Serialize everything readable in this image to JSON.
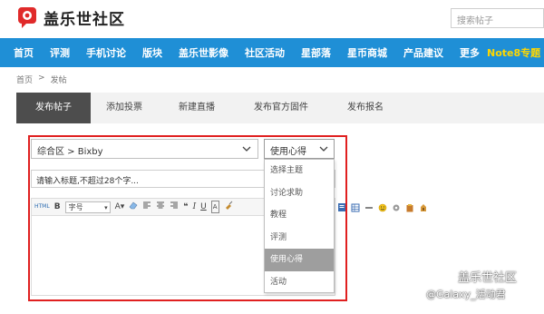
{
  "header": {
    "logo_text": "盖乐世社区",
    "search_placeholder": "搜索帖子"
  },
  "nav": {
    "items": [
      "首页",
      "评测",
      "手机讨论",
      "版块",
      "盖乐世影像",
      "社区活动",
      "星部落",
      "星币商城",
      "产品建议",
      "更多"
    ],
    "highlight": "Note8专题"
  },
  "breadcrumb": [
    "首页",
    ">",
    "发帖"
  ],
  "tabs": [
    {
      "label": "发布帖子",
      "active": true
    },
    {
      "label": "添加投票",
      "active": false
    },
    {
      "label": "新建直播",
      "active": false
    },
    {
      "label": "发布官方固件",
      "active": false
    },
    {
      "label": "发布报名",
      "active": false
    }
  ],
  "form": {
    "forum_select_value": "综合区 > Bixby",
    "type_select_value": "使用心得",
    "title_placeholder": "请输入标题,不超过28个字...",
    "toolbar": {
      "html_label": "HTML",
      "bold": "B",
      "font_label": "字号",
      "italic": "I",
      "underline": "U",
      "font_color": "A",
      "quote": "66"
    },
    "dropdown_options": [
      "选择主题",
      "讨论求助",
      "教程",
      "评测",
      "使用心得",
      "活动"
    ],
    "dropdown_selected": "使用心得"
  },
  "watermark": {
    "line1": "盖乐世社区",
    "line2": "@Galaxy_活动君"
  },
  "colors": {
    "nav_bg": "#1f8fd6",
    "highlight": "#ffd700",
    "frame": "#e02020",
    "tab_active": "#4d4d4d"
  }
}
